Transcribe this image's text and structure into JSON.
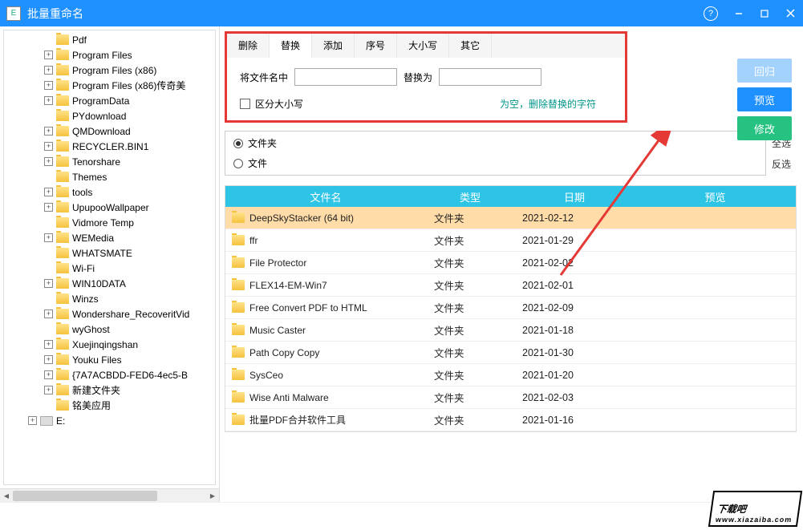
{
  "window": {
    "title": "批量重命名"
  },
  "tree": [
    {
      "label": "Pdf",
      "exp": ""
    },
    {
      "label": "Program Files",
      "exp": "+"
    },
    {
      "label": "Program Files (x86)",
      "exp": "+"
    },
    {
      "label": "Program Files (x86)传奇美",
      "exp": "+"
    },
    {
      "label": "ProgramData",
      "exp": "+"
    },
    {
      "label": "PYdownload",
      "exp": ""
    },
    {
      "label": "QMDownload",
      "exp": "+"
    },
    {
      "label": "RECYCLER.BIN1",
      "exp": "+"
    },
    {
      "label": "Tenorshare",
      "exp": "+"
    },
    {
      "label": "Themes",
      "exp": ""
    },
    {
      "label": "tools",
      "exp": "+"
    },
    {
      "label": "UpupooWallpaper",
      "exp": "+"
    },
    {
      "label": "Vidmore Temp",
      "exp": ""
    },
    {
      "label": "WEMedia",
      "exp": "+"
    },
    {
      "label": "WHATSMATE",
      "exp": ""
    },
    {
      "label": "Wi-Fi",
      "exp": ""
    },
    {
      "label": "WIN10DATA",
      "exp": "+"
    },
    {
      "label": "Winzs",
      "exp": ""
    },
    {
      "label": "Wondershare_RecoveritVid",
      "exp": "+"
    },
    {
      "label": "wyGhost",
      "exp": ""
    },
    {
      "label": "Xuejinqingshan",
      "exp": "+"
    },
    {
      "label": "Youku Files",
      "exp": "+"
    },
    {
      "label": "{7A7ACBDD-FED6-4ec5-B",
      "exp": "+"
    },
    {
      "label": "新建文件夹",
      "exp": "+"
    },
    {
      "label": "铭美应用",
      "exp": ""
    }
  ],
  "tree_tail": {
    "label": "E:",
    "exp": "+"
  },
  "tabs": [
    "删除",
    "替换",
    "添加",
    "序号",
    "大小写",
    "其它"
  ],
  "active_tab": 1,
  "panel": {
    "label_from": "将文件名中",
    "label_to": "替换为",
    "case_label": "区分大小写",
    "hint": "为空，删除替换的字符"
  },
  "buttons": {
    "b1": "回归",
    "b2": "预览",
    "b3": "修改"
  },
  "radios": {
    "folder": "文件夹",
    "file": "文件"
  },
  "side_labels": {
    "all": "全选",
    "inv": "反选"
  },
  "table": {
    "headers": {
      "name": "文件名",
      "type": "类型",
      "date": "日期",
      "preview": "预览"
    },
    "rows": [
      {
        "name": "DeepSkyStacker (64 bit)",
        "type": "文件夹",
        "date": "2021-02-12",
        "sel": true
      },
      {
        "name": "ffr",
        "type": "文件夹",
        "date": "2021-01-29"
      },
      {
        "name": "File Protector",
        "type": "文件夹",
        "date": "2021-02-02"
      },
      {
        "name": "FLEX14-EM-Win7",
        "type": "文件夹",
        "date": "2021-02-01"
      },
      {
        "name": "Free Convert PDF to HTML",
        "type": "文件夹",
        "date": "2021-02-09"
      },
      {
        "name": "Music Caster",
        "type": "文件夹",
        "date": "2021-01-18"
      },
      {
        "name": "Path Copy Copy",
        "type": "文件夹",
        "date": "2021-01-30"
      },
      {
        "name": "SysCeo",
        "type": "文件夹",
        "date": "2021-01-20"
      },
      {
        "name": "Wise Anti Malware",
        "type": "文件夹",
        "date": "2021-02-03"
      },
      {
        "name": "批量PDF合并软件工具",
        "type": "文件夹",
        "date": "2021-01-16"
      }
    ]
  },
  "watermark": {
    "big": "下载吧",
    "small": "www.xiazaiba.com"
  }
}
